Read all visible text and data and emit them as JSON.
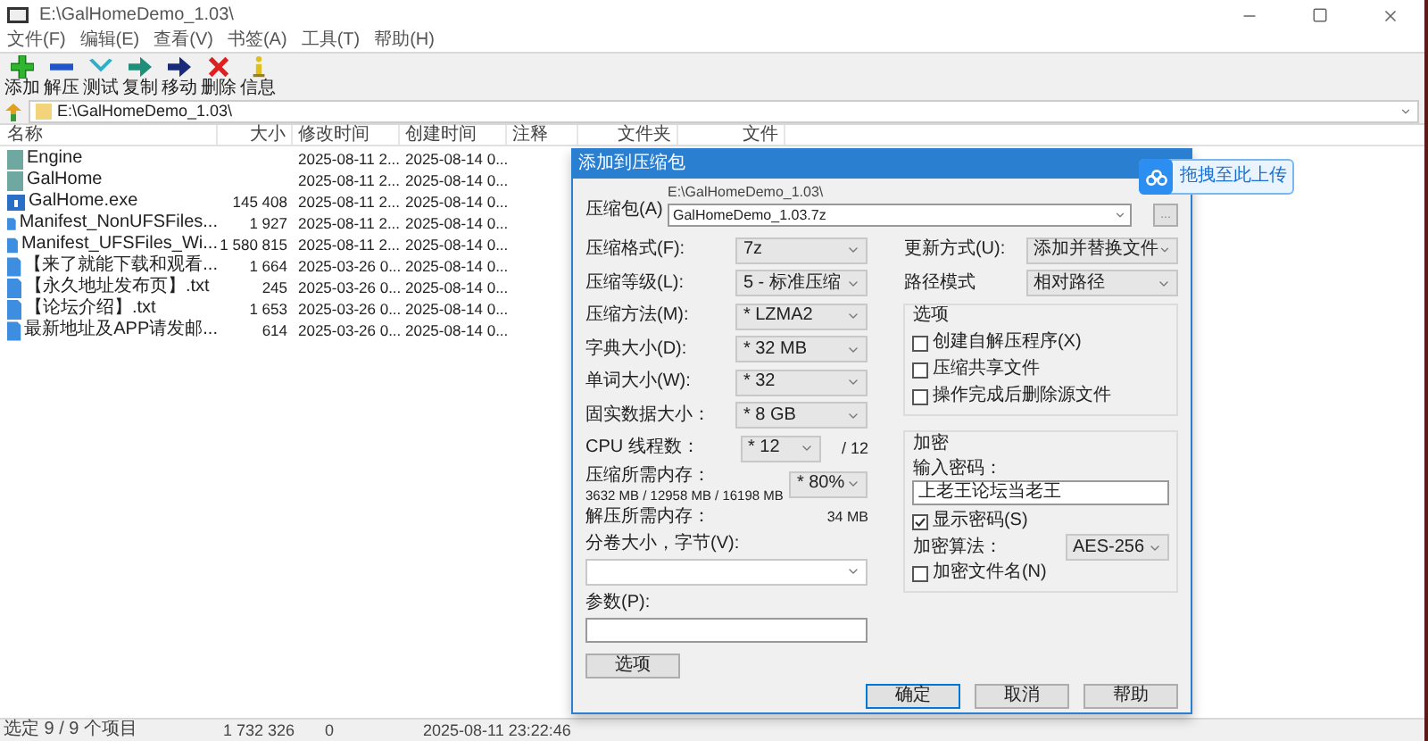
{
  "window": {
    "title": "E:\\GalHomeDemo_1.03\\"
  },
  "menu": [
    "文件(F)",
    "编辑(E)",
    "查看(V)",
    "书签(A)",
    "工具(T)",
    "帮助(H)"
  ],
  "toolbar": [
    {
      "kind": "add",
      "label": "添加"
    },
    {
      "kind": "extract",
      "label": "解压"
    },
    {
      "kind": "test",
      "label": "测试"
    },
    {
      "kind": "copy",
      "label": "复制"
    },
    {
      "kind": "move",
      "label": "移动"
    },
    {
      "kind": "delete",
      "label": "删除"
    },
    {
      "kind": "info",
      "label": "信息"
    }
  ],
  "address": {
    "path": "E:\\GalHomeDemo_1.03\\"
  },
  "table": {
    "columns": [
      "名称",
      "大小",
      "修改时间",
      "创建时间",
      "注释",
      "文件夹",
      "文件"
    ],
    "rows": [
      {
        "kind": "folder",
        "name": "Engine",
        "size": "",
        "modified": "2025-08-11 2...",
        "created": "2025-08-14 0..."
      },
      {
        "kind": "folder",
        "name": "GalHome",
        "size": "",
        "modified": "2025-08-11 2...",
        "created": "2025-08-14 0..."
      },
      {
        "kind": "exe",
        "name": "GalHome.exe",
        "size": "145 408",
        "modified": "2025-08-11 2...",
        "created": "2025-08-14 0..."
      },
      {
        "kind": "file",
        "name": "Manifest_NonUFSFiles...",
        "size": "1 927",
        "modified": "2025-08-11 2...",
        "created": "2025-08-14 0..."
      },
      {
        "kind": "file",
        "name": "Manifest_UFSFiles_Wi...",
        "size": "1 580 815",
        "modified": "2025-08-11 2...",
        "created": "2025-08-14 0..."
      },
      {
        "kind": "file",
        "name": "【来了就能下载和观看...",
        "size": "1 664",
        "modified": "2025-03-26 0...",
        "created": "2025-08-14 0..."
      },
      {
        "kind": "file",
        "name": "【永久地址发布页】.txt",
        "size": "245",
        "modified": "2025-03-26 0...",
        "created": "2025-08-14 0..."
      },
      {
        "kind": "file",
        "name": "【论坛介绍】.txt",
        "size": "1 653",
        "modified": "2025-03-26 0...",
        "created": "2025-08-14 0..."
      },
      {
        "kind": "file",
        "name": "最新地址及APP请发邮...",
        "size": "614",
        "modified": "2025-03-26 0...",
        "created": "2025-08-14 0..."
      }
    ]
  },
  "status_bar": [
    "选定 9 / 9 个项目",
    "1 732 326",
    "0",
    "2025-08-11 23:22:46"
  ],
  "dialog": {
    "title": "添加到压缩包",
    "archive_label": "压缩包(A)",
    "archive_dir": "E:\\GalHomeDemo_1.03\\",
    "archive_name": "GalHomeDemo_1.03.7z",
    "browse": "...",
    "left": [
      {
        "kind": "combo",
        "label": "压缩格式(F):",
        "value": "7z"
      },
      {
        "kind": "combo",
        "label": "压缩等级(L):",
        "value": "5 - 标准压缩"
      },
      {
        "kind": "combo",
        "label": "压缩方法(M):",
        "value": "* LZMA2"
      },
      {
        "kind": "combo",
        "label": "字典大小(D):",
        "value": "* 32 MB"
      },
      {
        "kind": "combo",
        "label": "单词大小(W):",
        "value": "* 32"
      },
      {
        "kind": "combo",
        "label": "固实数据大小：",
        "value": "* 8 GB"
      },
      {
        "kind": "threads",
        "label": "CPU 线程数：",
        "value": "* 12",
        "suffix": "/ 12"
      },
      {
        "kind": "memory",
        "label": "压缩所需内存：",
        "detail": "3632 MB / 12958 MB / 16198 MB",
        "value": "* 80%"
      },
      {
        "kind": "info",
        "label": "解压所需内存：",
        "value": "34 MB"
      },
      {
        "kind": "combo_below",
        "label": "分卷大小，字节(V):"
      },
      {
        "kind": "field_below",
        "label": "参数(P):"
      }
    ],
    "update_mode": {
      "label": "更新方式(U):",
      "value": "添加并替换文件"
    },
    "path_mode": {
      "label": "路径模式",
      "value": "相对路径"
    },
    "options": {
      "title": "选项",
      "checkboxes": [
        {
          "label": "创建自解压程序(X)",
          "checked": false
        },
        {
          "label": "压缩共享文件",
          "checked": false
        },
        {
          "label": "操作完成后删除源文件",
          "checked": false
        }
      ]
    },
    "encryption": {
      "title": "加密",
      "password_label": "输入密码：",
      "password": "上老王论坛当老王",
      "show_password": {
        "label": "显示密码(S)",
        "checked": true
      },
      "method_label": "加密算法：",
      "method": "AES-256",
      "encrypt_names": {
        "label": "加密文件名(N)",
        "checked": false
      }
    },
    "options_button": "选项",
    "buttons": [
      {
        "label": "确定",
        "selected": true
      },
      {
        "label": "取消",
        "selected": false
      },
      {
        "label": "帮助",
        "selected": false
      }
    ]
  },
  "upload_badge": {
    "text": "拖拽至此上传"
  }
}
